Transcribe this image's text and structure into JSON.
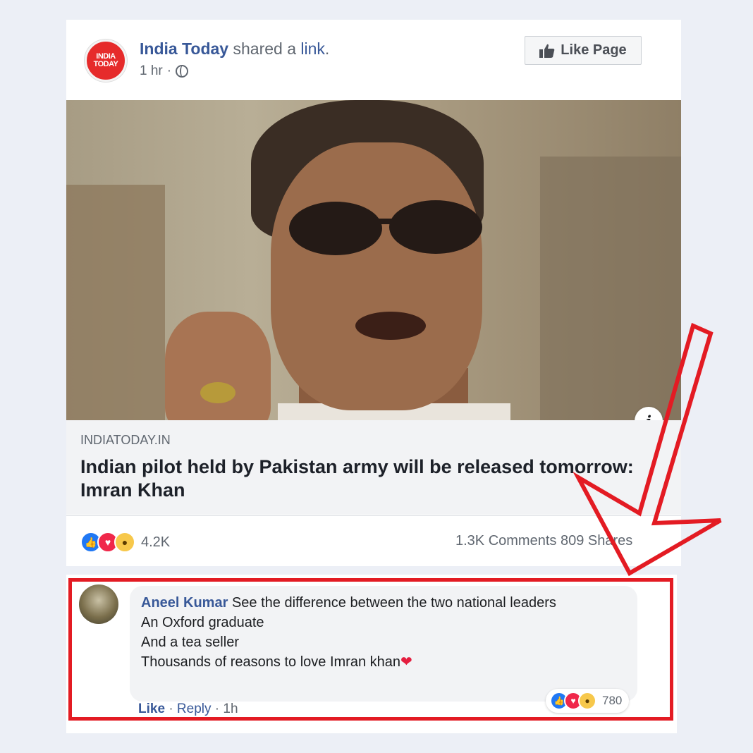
{
  "post": {
    "page_name": "India Today",
    "shared_text": "shared a",
    "link_word": "link",
    "timestamp": "1 hr",
    "like_page_label": "Like Page",
    "logo_text_line1": "INDIA",
    "logo_text_line2": "TODAY"
  },
  "link_preview": {
    "domain": "INDIATODAY.IN",
    "headline": "Indian pilot held by Pakistan army will be released tomorrow: Imran Khan",
    "info_glyph": "i"
  },
  "stats": {
    "reactions_count": "4.2K",
    "comments": "1.3K Comments",
    "shares": "809 Shares"
  },
  "comment": {
    "author": "Aneel Kumar",
    "lines": [
      "See the difference between the two national leaders",
      "An Oxford graduate",
      "And a tea seller",
      "Thousands of reasons to love Imran khan"
    ],
    "heart": "❤",
    "reactions_count": "780",
    "actions": {
      "like": "Like",
      "reply": "Reply",
      "time": "1h"
    }
  },
  "colors": {
    "link_blue": "#385898",
    "highlight_red": "#e31b23",
    "like_blue": "#2078f4",
    "love_red": "#f0284a"
  }
}
